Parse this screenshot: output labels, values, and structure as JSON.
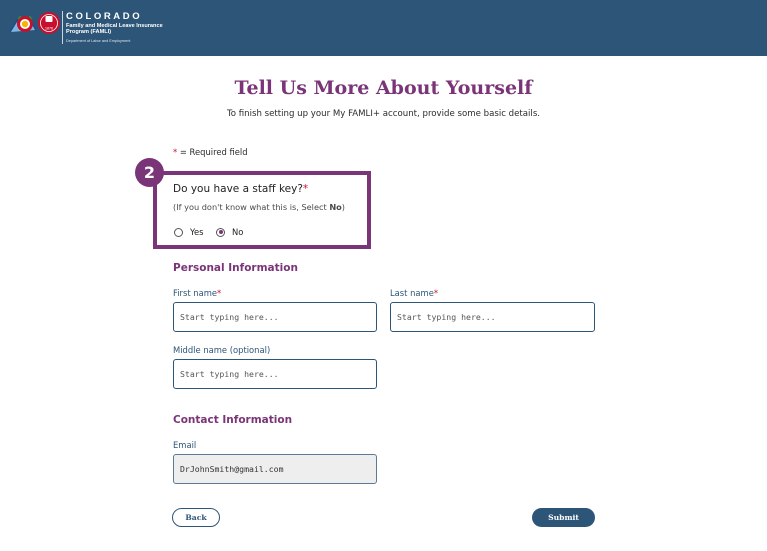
{
  "header": {
    "state": "COLORADO",
    "program": "Family and Medical Leave Insurance Program (FAMLI)",
    "department": "Department of Labor and Employment",
    "logo_seal_text": "1876",
    "colors": {
      "bar": "#2d5577",
      "accent": "#7a3478",
      "flag_red": "#c8102e",
      "flag_gold": "#f2b705",
      "flag_blue": "#1f4e8c"
    }
  },
  "page": {
    "title": "Tell Us More About Yourself",
    "subtitle": "To finish setting up your My FAMLI+ account, provide some basic details.",
    "required_star": "*",
    "required_note": " = Required field"
  },
  "step": {
    "number": "2",
    "question": "Do you have a staff key?",
    "question_star": "*",
    "hint_prefix": "(If you don't know what this is, Select ",
    "hint_bold": "No",
    "hint_suffix": ")",
    "options": [
      {
        "label": "Yes",
        "selected": false
      },
      {
        "label": "No",
        "selected": true
      }
    ]
  },
  "personal": {
    "title": "Personal  Information",
    "first_name": {
      "label": "First name",
      "star": "*",
      "placeholder": "Start typing here...",
      "value": ""
    },
    "last_name": {
      "label": "Last name",
      "star": "*",
      "placeholder": "Start typing here...",
      "value": ""
    },
    "middle_name": {
      "label": "Middle name (optional)",
      "placeholder": "Start typing here...",
      "value": ""
    }
  },
  "contact": {
    "title": "Contact Information",
    "email": {
      "label": "Email",
      "value": "DrJohnSmith@gmail.com"
    }
  },
  "actions": {
    "back": "Back",
    "submit": "Submit"
  }
}
